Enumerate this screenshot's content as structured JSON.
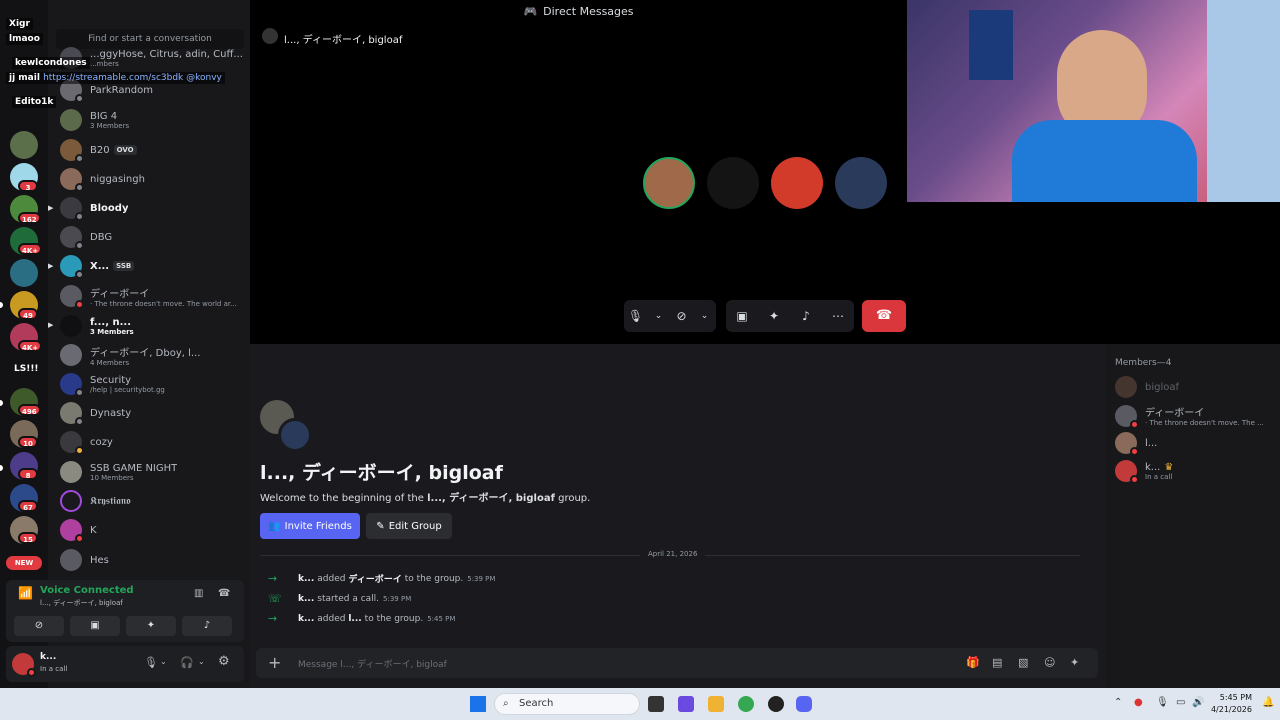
{
  "window": {
    "title": "Direct Messages"
  },
  "search": {
    "placeholder": "Find or start a conversation"
  },
  "overlay_chat": [
    {
      "user": "Xigr"
    },
    {
      "user": "lmaoo"
    },
    {
      "user": "kewlcondones"
    },
    {
      "user": "jj mail",
      "message": "https://streamable.com/sc3bdk @konvy"
    },
    {
      "user": "Edito1k"
    }
  ],
  "rail": {
    "badges": [
      "3",
      "162",
      "4K+",
      "49",
      "4K+",
      "496",
      "10",
      "8",
      "67",
      "15"
    ],
    "text_items": [
      "LS!!!"
    ],
    "new_label": "NEW"
  },
  "dm_list": [
    {
      "name": "...ggyHose, Citrus, adin, Cuff...",
      "sub": "...mbers"
    },
    {
      "name": "ParkRandom",
      "sub": ""
    },
    {
      "name": "BIG 4",
      "sub": "3 Members"
    },
    {
      "name": "B20",
      "tag": "OVO",
      "sub": ""
    },
    {
      "name": "niggasingh",
      "sub": ""
    },
    {
      "name": "Bloody",
      "sub": ""
    },
    {
      "name": "DBG",
      "sub": ""
    },
    {
      "name": "X...",
      "tag": "SSB",
      "sub": ""
    },
    {
      "name": "ディーボーイ",
      "sub": "· The throne doesn't move. The world ar..."
    },
    {
      "name": "f..., n...",
      "sub": "3 Members"
    },
    {
      "name": "ディーボーイ, Dboy, l...",
      "sub": "4 Members"
    },
    {
      "name": "Security",
      "sub": "/help | securitybot.gg"
    },
    {
      "name": "Dynasty",
      "sub": ""
    },
    {
      "name": "cozy",
      "sub": ""
    },
    {
      "name": "SSB GAME NIGHT",
      "sub": "10 Members"
    },
    {
      "name": "𝕶𝖗𝖞𝖘𝖙𝖎𝖆𝖓𝖔",
      "sub": ""
    },
    {
      "name": "K",
      "sub": ""
    },
    {
      "name": "Hes",
      "sub": ""
    }
  ],
  "voice": {
    "status": "Voice Connected",
    "channel": "l..., ディーボーイ, bigloaf"
  },
  "user_panel": {
    "name": "k...",
    "status": "In a call"
  },
  "call": {
    "header": "l..., ディーボーイ, bigloaf"
  },
  "chat": {
    "title": "l..., ディーボーイ, bigloaf",
    "welcome_prefix": "Welcome to the beginning of the",
    "welcome_group": "l..., ディーボーイ, bigloaf",
    "welcome_suffix": "group.",
    "invite_label": "Invite Friends",
    "edit_label": "Edit Group",
    "date": "April 21, 2026",
    "messages": [
      {
        "actor": "k...",
        "action": "added",
        "target": "ディーボーイ",
        "rest": "to the group.",
        "time": "5:39 PM"
      },
      {
        "actor": "k...",
        "action": "started a call.",
        "target": "",
        "rest": "",
        "time": "5:39 PM"
      },
      {
        "actor": "k...",
        "action": "added",
        "target": "l...",
        "rest": "to the group.",
        "time": "5:45 PM"
      }
    ],
    "composer_placeholder": "Message l..., ディーボーイ, bigloaf"
  },
  "members": {
    "header": "Members—4",
    "list": [
      {
        "name": "bigloaf",
        "sub": ""
      },
      {
        "name": "ディーボーイ",
        "sub": "· The throne doesn't move. The ..."
      },
      {
        "name": "l...",
        "sub": ""
      },
      {
        "name": "k...",
        "sub": "In a call"
      }
    ]
  },
  "taskbar": {
    "search_label": "Search",
    "time": "5:45 PM",
    "date": "4/21/2026"
  },
  "colors": {
    "accent": "#5865f2",
    "danger": "#da373c",
    "online": "#23a55a"
  }
}
